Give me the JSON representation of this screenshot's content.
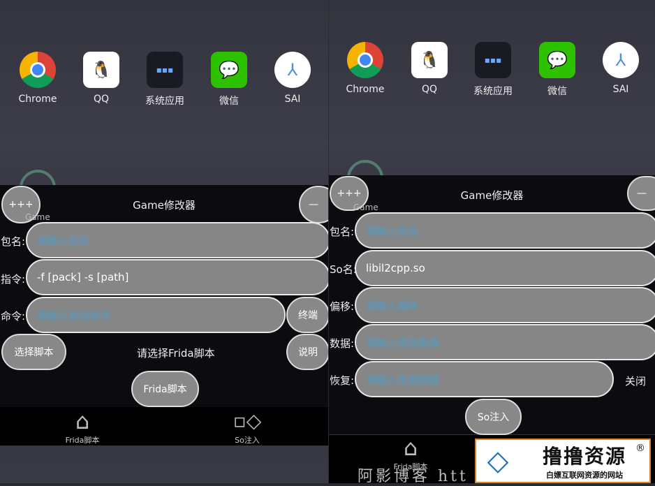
{
  "apps": [
    {
      "label": "Chrome",
      "icon": "chrome-icon"
    },
    {
      "label": "QQ",
      "icon": "qq-penguin-icon"
    },
    {
      "label": "系统应用",
      "icon": "folder-icon"
    },
    {
      "label": "微信",
      "icon": "wechat-icon"
    },
    {
      "label": "SAI",
      "icon": "sai-icon"
    }
  ],
  "game_label": "Game",
  "left": {
    "title": "Game修改器",
    "plus_button": "+++",
    "minus_button": "—",
    "package_label": "包名:",
    "package_placeholder": "请输入包名",
    "instruction_label": "指令:",
    "instruction_value": "-f [pack] -s [path]",
    "command_label": "命令:",
    "command_placeholder": "请输入启动命令",
    "terminal_button": "终端",
    "select_script_button": "选择脚本",
    "script_status": "请选择Frida脚本",
    "help_button": "说明",
    "frida_button": "Frida脚本",
    "nav": [
      {
        "label": "Frida脚本",
        "icon": "home-icon"
      },
      {
        "label": "So注入",
        "icon": "grid-icon"
      }
    ]
  },
  "right": {
    "title": "Game修改器",
    "plus_button": "+++",
    "minus_button": "—",
    "package_label": "包名:",
    "package_placeholder": "请输入包名",
    "so_label": "So名:",
    "so_value": "libil2cpp.so",
    "offset_label": "偏移:",
    "offset_placeholder": "请输入偏移",
    "data_label": "数据:",
    "data_placeholder": "请输入修改数据",
    "restore_label": "恢复:",
    "restore_placeholder": "请输入恢复数据",
    "close_button": "关闭",
    "inject_button": "So注入",
    "nav": [
      {
        "label": "Frida脚本",
        "icon": "home-icon"
      }
    ]
  },
  "watermark": {
    "logo_title": "撸撸资源",
    "logo_subtitle": "白嫖互联网资源的网站",
    "registered": "®",
    "blog_text": "阿影博客 htt"
  }
}
